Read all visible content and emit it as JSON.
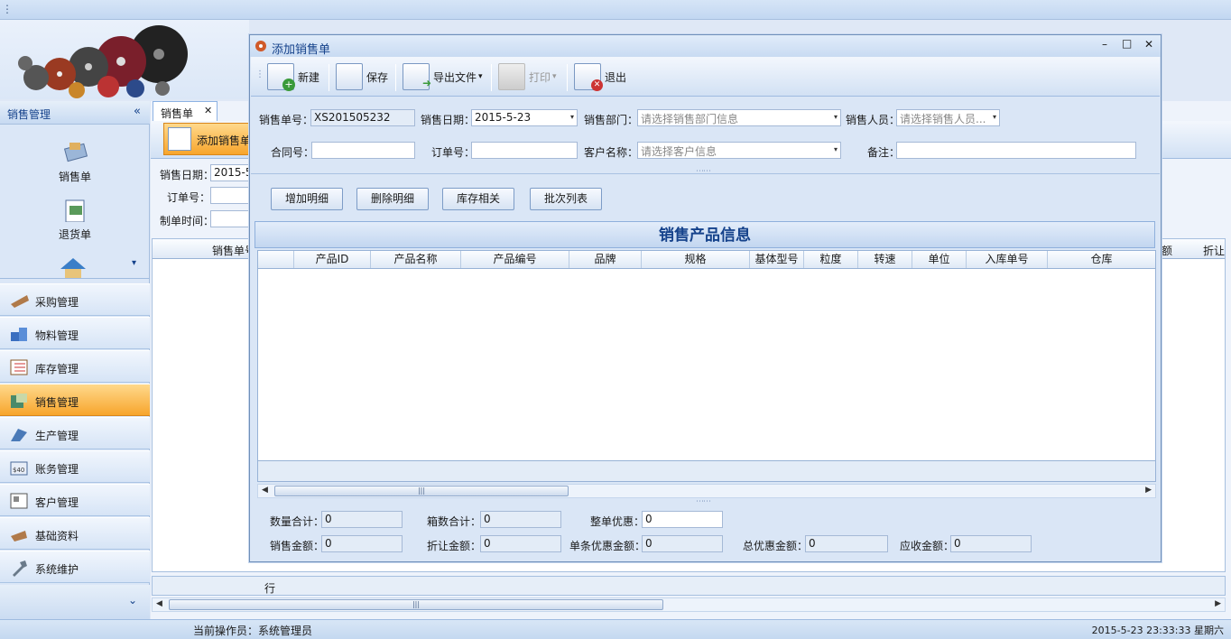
{
  "app": {
    "title_menu_glyph": "⋮"
  },
  "sidebar": {
    "header": "销售管理",
    "collapse_glyph": "«",
    "sub_items": [
      {
        "label": "销售单"
      },
      {
        "label": "退货单"
      }
    ],
    "more_glyph": "▾",
    "nav": [
      {
        "label": "采购管理"
      },
      {
        "label": "物料管理"
      },
      {
        "label": "库存管理"
      },
      {
        "label": "销售管理"
      },
      {
        "label": "生产管理"
      },
      {
        "label": "账务管理"
      },
      {
        "label": "客户管理"
      },
      {
        "label": "基础资料"
      },
      {
        "label": "系统维护"
      }
    ],
    "footer_glyph": "⌄"
  },
  "main": {
    "tab_label": "销售单",
    "tab_close": "✕",
    "add_button": "添加销售单",
    "filters": {
      "date_label": "销售日期：",
      "date_value": "2015-5",
      "order_label": "订单号：",
      "time_label": "制单时间："
    },
    "grid_headers": {
      "sale_no": "销售单号",
      "amount_tail": "额",
      "discount": "折让"
    },
    "footer_row": "行"
  },
  "status": {
    "operator": "当前操作员：系统管理员",
    "datetime": "2015-5-23  23:33:33  星期六"
  },
  "dialog": {
    "title": "添加销售单",
    "window_controls": {
      "min": "–",
      "max": "□",
      "close": "✕"
    },
    "toolbar": {
      "new": "新建",
      "save": "保存",
      "export": "导出文件",
      "print": "打印",
      "exit": "退出",
      "dropdown": "▾"
    },
    "form": {
      "sale_no_label": "销售单号：",
      "sale_no_value": "XS201505232",
      "sale_date_label": "销售日期：",
      "sale_date_value": "2015-5-23",
      "dept_label": "销售部门：",
      "dept_placeholder": "请选择销售部门信息",
      "person_label": "销售人员：",
      "person_placeholder": "请选择销售人员...",
      "contract_label": "合同号：",
      "order_label": "订单号：",
      "customer_label": "客户名称：",
      "customer_placeholder": "请选择客户信息",
      "remark_label": "备注：",
      "dropdown": "▾"
    },
    "actions": {
      "add_detail": "增加明细",
      "delete_detail": "删除明细",
      "stock": "库存相关",
      "batch": "批次列表"
    },
    "grid": {
      "title": "销售产品信息",
      "columns": [
        "产品ID",
        "产品名称",
        "产品编号",
        "品牌",
        "规格",
        "基体型号",
        "粒度",
        "转速",
        "单位",
        "入库单号",
        "仓库"
      ]
    },
    "totals": {
      "qty_label": "数量合计：",
      "qty_value": "0",
      "box_label": "箱数合计：",
      "box_value": "0",
      "order_discount_label": "整单优惠：",
      "order_discount_value": "0",
      "sale_amount_label": "销售金额：",
      "sale_amount_value": "0",
      "discount_amount_label": "折让金额：",
      "discount_amount_value": "0",
      "item_discount_label": "单条优惠金额：",
      "item_discount_value": "0",
      "total_discount_label": "总优惠金额：",
      "total_discount_value": "0",
      "receivable_label": "应收金额：",
      "receivable_value": "0"
    },
    "splitter_glyph": "⋯⋯",
    "scroll_left": "◀",
    "scroll_right": "▶",
    "thumb_grip": "|||"
  }
}
